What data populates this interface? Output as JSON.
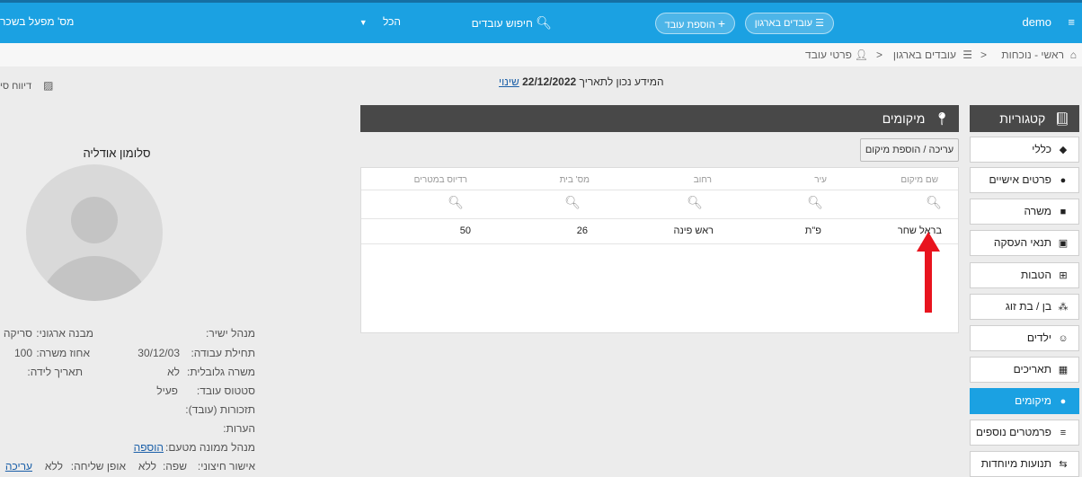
{
  "topbar": {
    "app_name": "demo",
    "employees_filter": "עובדים בארגון",
    "add_employee": "הוספת עובד",
    "search_employees": "חיפוש עובדים",
    "scope_select": "הכל",
    "factory_label": "מס' מפעל בשכר"
  },
  "breadcrumb": {
    "home": "ראשי - נוכחות",
    "org_employees": "עובדים בארגון",
    "employee_details": "פרטי עובד"
  },
  "info": {
    "valid_text": "המידע נכון לתאריך",
    "date": "22/12/2022",
    "change_link": "שינוי"
  },
  "categories": {
    "title": "קטגוריות",
    "items": [
      {
        "label": "כללי",
        "icon": "layers-icon"
      },
      {
        "label": "פרטים אישיים",
        "icon": "person-icon"
      },
      {
        "label": "משרה",
        "icon": "briefcase-icon"
      },
      {
        "label": "תנאי העסקה",
        "icon": "clipboard-icon"
      },
      {
        "label": "הטבות",
        "icon": "plus-box-icon"
      },
      {
        "label": "בן / בת זוג",
        "icon": "people-icon"
      },
      {
        "label": "ילדים",
        "icon": "child-icon"
      },
      {
        "label": "תאריכים",
        "icon": "calendar-icon"
      },
      {
        "label": "מיקומים",
        "icon": "pin-icon"
      },
      {
        "label": "פרמטרים נוספים",
        "icon": "list-plus-icon"
      },
      {
        "label": "תנועות מיוחדות",
        "icon": "movement-icon"
      }
    ],
    "active_index": 8
  },
  "locations": {
    "title": "מיקומים",
    "edit_button": "עריכה / הוספת מיקום",
    "columns": [
      "שם מיקום",
      "עיר",
      "רחוב",
      "מס' בית",
      "רדיוס במטרים"
    ],
    "rows": [
      [
        "בראל שחר",
        "פ\"ת",
        "ראש פינה",
        "26",
        "50"
      ]
    ]
  },
  "profile": {
    "report_link": "דיווח סי",
    "name": "סלומון אודליה",
    "details": {
      "manager_label": "מנהל ישיר:",
      "org_structure_label": "מבנה ארגוני:",
      "org_structure_value": "סריקה",
      "start_label": "תחילת עבודה:",
      "start_value": "30/12/03",
      "position_pct_label": "אחוז משרה:",
      "position_pct_value": "100",
      "global_label": "משרה גלובלית:",
      "global_value": "לא",
      "birth_label": "תאריך לידה:",
      "status_label": "סטטוס עובד:",
      "status_value": "פעיל",
      "reminders_label": "תזכורות (עובד):",
      "notes_label": "הערות:",
      "deputy_label": "מנהל ממונה מטעם:",
      "deputy_link": "הוספה",
      "ext_approval_label": "אישור חיצוני:",
      "language_label": "שפה:",
      "language_value": "ללא",
      "send_label": "אופן שליחה:",
      "send_value": "ללא",
      "edit_link": "עריכה"
    }
  }
}
